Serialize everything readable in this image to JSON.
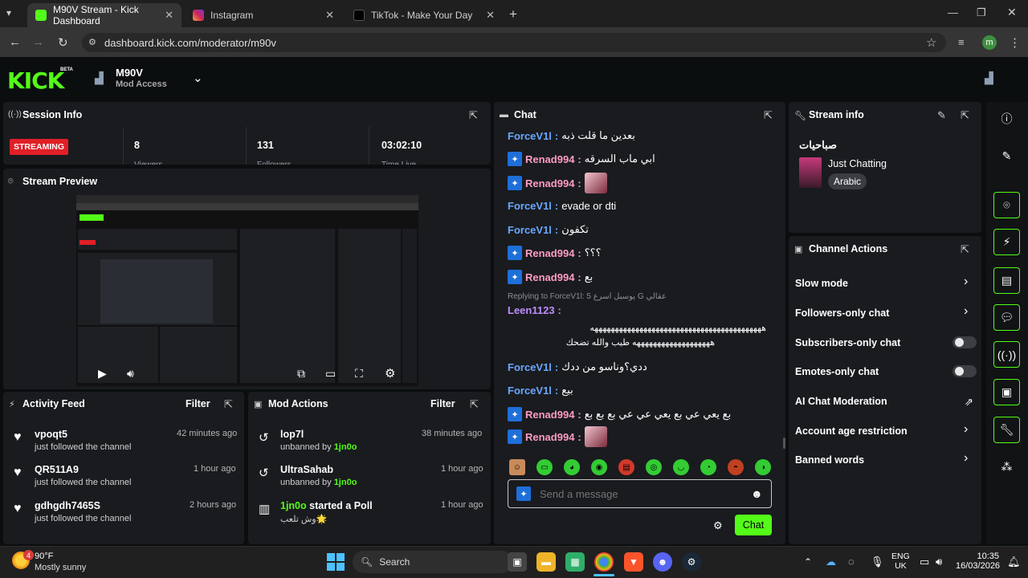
{
  "browser": {
    "tabs": [
      {
        "title": "M90V Stream - Kick Dashboard",
        "active": true
      },
      {
        "title": "Instagram",
        "active": false
      },
      {
        "title": "TikTok - Make Your Day",
        "active": false
      }
    ],
    "url": "dashboard.kick.com/moderator/m90v",
    "profile_initial": "m"
  },
  "header": {
    "logo": "KICK",
    "beta": "BETA",
    "channel_name": "M90V",
    "access": "Mod Access"
  },
  "session": {
    "title": "Session Info",
    "status": "STREAMING",
    "viewers": "8",
    "viewers_label": "Viewers",
    "followers": "131",
    "followers_label": "Followers",
    "time": "03:02:10",
    "time_label": "Time Live"
  },
  "preview": {
    "title": "Stream Preview"
  },
  "activity": {
    "title": "Activity Feed",
    "filter": "Filter",
    "items": [
      {
        "name": "vpoqt5",
        "sub": "just followed the channel",
        "time": "42 minutes ago"
      },
      {
        "name": "QR511A9",
        "sub": "just followed the channel",
        "time": "1 hour ago"
      },
      {
        "name": "gdhgdh7465S",
        "sub": "just followed the channel",
        "time": "2 hours ago"
      }
    ]
  },
  "mod_actions": {
    "title": "Mod Actions",
    "filter": "Filter",
    "items": [
      {
        "name": "lop7l",
        "verb": "unbanned by",
        "by": "1jn0o",
        "time": "38 minutes ago"
      },
      {
        "name": "UltraSahab",
        "verb": "unbanned by",
        "by": "1jn0o",
        "time": "1 hour ago"
      },
      {
        "name": "1jn0o",
        "verb": "started a Poll",
        "by": "وش تلعب🌟",
        "time": "1 hour ago"
      }
    ]
  },
  "chat": {
    "title": "Chat",
    "messages": [
      {
        "user": "ForceV1l",
        "color": "blue",
        "badge": false,
        "text": "بعدين ما قلت ذبه"
      },
      {
        "user": "Renad994",
        "color": "pink",
        "badge": true,
        "text": "ابي ماب السرقه"
      },
      {
        "user": "Renad994",
        "color": "pink",
        "badge": true,
        "text": "",
        "emote": true
      },
      {
        "user": "ForceV1l",
        "color": "blue",
        "badge": false,
        "text": "evade or dti"
      },
      {
        "user": "ForceV1l",
        "color": "blue",
        "badge": false,
        "text": "تكفون"
      },
      {
        "user": "Renad994",
        "color": "pink",
        "badge": true,
        "text": "؟؟؟"
      },
      {
        "user": "Renad994",
        "color": "pink",
        "badge": true,
        "text": "بع"
      }
    ],
    "reply_note": "Replying to ForceV1l: 5 يوسبل اسرع G عقالي",
    "reply_user": "Leen1123",
    "reply_line1": "ههههههههههههههههههههههههههههههههههههههههههه",
    "reply_line2": "هههههههههههههههههههه طيب والله تضحك",
    "messages2": [
      {
        "user": "ForceV1l",
        "color": "blue",
        "badge": false,
        "text": "ددي؟وناسو من ددك"
      },
      {
        "user": "ForceV1l",
        "color": "blue",
        "badge": false,
        "text": "بيع"
      },
      {
        "user": "Renad994",
        "color": "pink",
        "badge": true,
        "text": "بع يعي عي بع يعي عي عي بع بع بع"
      },
      {
        "user": "Renad994",
        "color": "pink",
        "badge": true,
        "text": "",
        "emote": true
      }
    ],
    "placeholder": "Send a message",
    "send": "Chat"
  },
  "stream_info": {
    "title": "Stream info",
    "stream_title": "صباحيات",
    "category": "Just Chatting",
    "tag": "Arabic"
  },
  "channel_actions": {
    "title": "Channel Actions",
    "items": [
      {
        "label": "Slow mode",
        "control": "chevron"
      },
      {
        "label": "Followers-only chat",
        "control": "chevron"
      },
      {
        "label": "Subscribers-only chat",
        "control": "toggle",
        "on": false
      },
      {
        "label": "Emotes-only chat",
        "control": "toggle",
        "on": false
      },
      {
        "label": "AI Chat Moderation",
        "control": "external"
      },
      {
        "label": "Account age restriction",
        "control": "chevron"
      },
      {
        "label": "Banned words",
        "control": "chevron"
      }
    ]
  },
  "taskbar": {
    "weather_temp": "90°F",
    "weather_desc": "Mostly sunny",
    "weather_badge": "4",
    "search": "Search",
    "lang1": "ENG",
    "lang2": "UK",
    "time": "10:35",
    "date": "16/03/2026"
  },
  "colors": {
    "accent": "#53fc18",
    "panel": "#191b1f",
    "bg": "#0b0e0f"
  }
}
